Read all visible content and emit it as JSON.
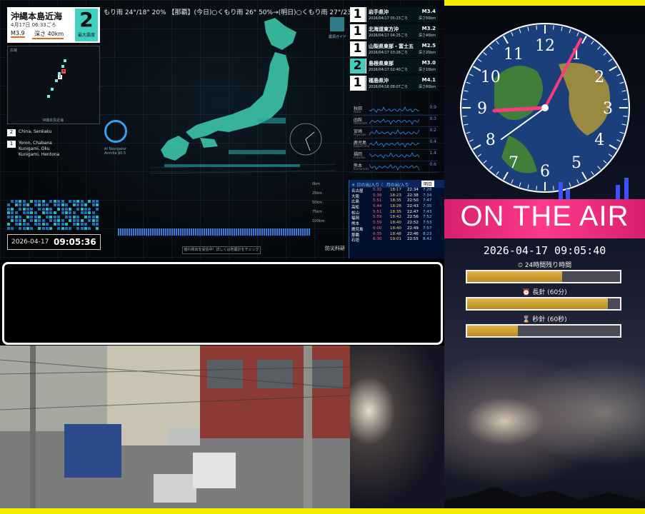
{
  "ticker": "もり雨 24°/18° 20% 【那覇】(今日)○くもり雨 26° 50%→(明日)○くもり雨 27°/23° 50% 【大東島】(今",
  "latest": {
    "region": "沖縄本島近海",
    "time": "4月17日 06:33ごろ",
    "magnitude": "M3.9",
    "depth": "深さ 40km",
    "intensity": "2",
    "intensity_label": "最大震度"
  },
  "minimap": {
    "title": "広域",
    "label": "沖縄本島近海"
  },
  "event_legend": [
    {
      "num": "2",
      "lines": [
        "China, Senkaku"
      ]
    },
    {
      "num": "1",
      "lines": [
        "Yoron, Chabana",
        "Kunigami, Oku",
        "Kunigami, Hentona"
      ]
    }
  ],
  "ai_navigator": [
    "AI Navigator",
    "Armilla β0.5"
  ],
  "clock": {
    "date": "2026-04-17",
    "time": "09:05:36"
  },
  "map_legend": "震源ガイド",
  "depth_scale": [
    "0km",
    "25km",
    "50km",
    "75km",
    "100km"
  ],
  "bottom_hint": "揺れ検出を受信中！詳しくは地震計をチェック",
  "source": "防災科研",
  "quakes": [
    {
      "intensity": "1",
      "name": "岩手県沖",
      "time": "2026/04/17 05:23ごろ",
      "mag": "M3.4",
      "depth": "深さ50km"
    },
    {
      "intensity": "1",
      "name": "北海道東方沖",
      "time": "2026/04/17 04:25ごろ",
      "mag": "M3.2",
      "depth": "深さ40km"
    },
    {
      "intensity": "1",
      "name": "山梨県東部・富士五",
      "time": "2026/04/17 03:28ごろ",
      "mag": "M2.5",
      "depth": "深さ20km"
    },
    {
      "intensity": "2",
      "name": "島根県東部",
      "time": "2026/04/17 02:40ごろ",
      "mag": "M3.0",
      "depth": "深さ10km"
    },
    {
      "intensity": "1",
      "name": "福島県沖",
      "time": "2026/04/16 08:07ごろ",
      "mag": "M4.1",
      "depth": "深さ60km"
    }
  ],
  "stations": [
    {
      "name": "秋田",
      "en": "Akita",
      "value": "0.9"
    },
    {
      "name": "函館",
      "en": "Hakodate",
      "value": "0.3"
    },
    {
      "name": "宮崎",
      "en": "Miyazaki",
      "value": "0.2"
    },
    {
      "name": "鹿児島",
      "en": "Kagoshima",
      "value": "0.4"
    },
    {
      "name": "福岡",
      "en": "Fukuoka",
      "value": "1.4"
    },
    {
      "name": "熊本",
      "en": "Kumamoto",
      "value": "0.6"
    }
  ],
  "sunmoon": {
    "sun_label": "日の出/入り",
    "moon_label": "月の出/入り",
    "tomorrow": "明日",
    "rows": [
      {
        "city": "名古屋",
        "sunrise": "5:32",
        "sunset": "18:17",
        "moonrise": "22:34",
        "moonset": "7:28"
      },
      {
        "city": "大阪",
        "sunrise": "5:38",
        "sunset": "18:23",
        "moonrise": "22:38",
        "moonset": "7:34"
      },
      {
        "city": "広島",
        "sunrise": "5:51",
        "sunset": "18:35",
        "moonrise": "22:50",
        "moonset": "7:47"
      },
      {
        "city": "高松",
        "sunrise": "5:44",
        "sunset": "18:28",
        "moonrise": "22:43",
        "moonset": "7:35"
      },
      {
        "city": "松山",
        "sunrise": "5:51",
        "sunset": "18:35",
        "moonrise": "22:47",
        "moonset": "7:43"
      },
      {
        "city": "福岡",
        "sunrise": "5:59",
        "sunset": "18:42",
        "moonrise": "22:56",
        "moonset": "7:52"
      },
      {
        "city": "熊本",
        "sunrise": "5:59",
        "sunset": "18:40",
        "moonrise": "22:52",
        "moonset": "7:53"
      },
      {
        "city": "鹿児島",
        "sunrise": "6:00",
        "sunset": "18:40",
        "moonrise": "22:49",
        "moonset": "7:57"
      },
      {
        "city": "那覇",
        "sunrise": "6:35",
        "sunset": "18:48",
        "moonrise": "22:46",
        "moonset": "8:23"
      },
      {
        "city": "石垣",
        "sunrise": "6:30",
        "sunset": "19:01",
        "moonrise": "22:55",
        "moonset": "8:42"
      }
    ]
  },
  "broadcast": {
    "on_air": "ON THE AIR",
    "datetime": "2026-04-17 09:05:40",
    "progress": [
      {
        "label": "24時間残り時間",
        "value": 0.62
      },
      {
        "label": "長針 (60分)",
        "value": 0.92
      },
      {
        "label": "秒針 (60秒)",
        "value": 0.33
      }
    ],
    "clock_numbers": [
      "12",
      "1",
      "2",
      "3",
      "4",
      "5",
      "6",
      "7",
      "8",
      "9",
      "10",
      "11"
    ]
  },
  "colors": {
    "accent_teal": "#3fd0c0",
    "on_air_pink": "#ff3a8a",
    "progress_gold": "#d2a436",
    "frame_yellow": "#f3ee00"
  }
}
